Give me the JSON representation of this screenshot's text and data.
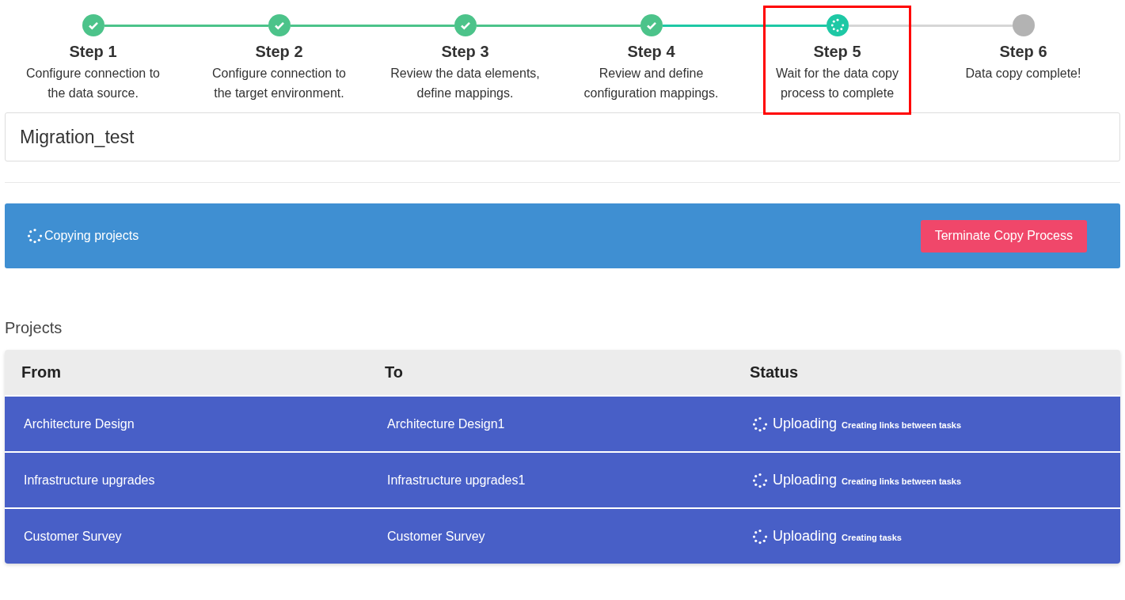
{
  "steps": [
    {
      "title": "Step 1",
      "description": "Configure connection to the data source.",
      "kind": "done",
      "highlighted": false
    },
    {
      "title": "Step 2",
      "description": "Configure connection to the target environment.",
      "kind": "done",
      "highlighted": false
    },
    {
      "title": "Step 3",
      "description": "Review the data elements, define mappings.",
      "kind": "done",
      "highlighted": false
    },
    {
      "title": "Step 4",
      "description": "Review and define configuration mappings.",
      "kind": "done",
      "highlighted": false
    },
    {
      "title": "Step 5",
      "description": "Wait for the data copy process to complete",
      "kind": "active",
      "highlighted": true
    },
    {
      "title": "Step 6",
      "description": "Data copy complete!",
      "kind": "pending",
      "highlighted": false
    }
  ],
  "name_field": {
    "value": "Migration_test"
  },
  "banner": {
    "message": "Copying projects",
    "button": "Terminate Copy Process"
  },
  "projects": {
    "title": "Projects",
    "columns": [
      "From",
      "To",
      "Status"
    ],
    "rows": [
      {
        "from": "Architecture Design",
        "to": "Architecture Design1",
        "status": "Uploading",
        "detail": "Creating links between tasks"
      },
      {
        "from": "Infrastructure upgrades",
        "to": "Infrastructure upgrades1",
        "status": "Uploading",
        "detail": "Creating links between tasks"
      },
      {
        "from": "Customer Survey",
        "to": "Customer Survey",
        "status": "Uploading",
        "detail": "Creating tasks"
      }
    ]
  }
}
